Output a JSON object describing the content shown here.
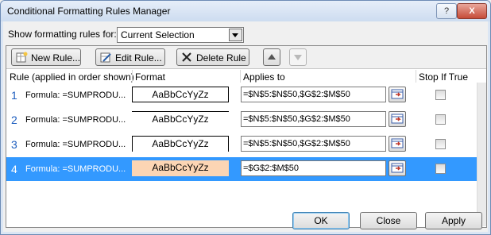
{
  "window": {
    "title": "Conditional Formatting Rules Manager",
    "help": "?",
    "close": "X"
  },
  "show_rules": {
    "label": "Show formatting rules for:",
    "value": "Current Selection"
  },
  "toolbar": {
    "new_rule": "New Rule...",
    "edit_rule": "Edit Rule...",
    "delete_rule": "Delete Rule"
  },
  "columns": {
    "rule": "Rule (applied in order shown)",
    "format": "Format",
    "applies_to": "Applies to",
    "stop_if_true": "Stop If True"
  },
  "rules": [
    {
      "num": "1",
      "text": "Formula: =SUMPRODU...",
      "preview": "AaBbCcYyZz",
      "applies": "=$N$5:$N$50,$G$2:$M$50",
      "stop": false,
      "selected": false
    },
    {
      "num": "2",
      "text": "Formula: =SUMPRODU...",
      "preview": "AaBbCcYyZz",
      "applies": "=$N$5:$N$50,$G$2:$M$50",
      "stop": false,
      "selected": false
    },
    {
      "num": "3",
      "text": "Formula: =SUMPRODU...",
      "preview": "AaBbCcYyZz",
      "applies": "=$N$5:$N$50,$G$2:$M$50",
      "stop": false,
      "selected": false
    },
    {
      "num": "4",
      "text": "Formula: =SUMPRODU...",
      "preview": "AaBbCcYyZz",
      "applies": "=$G$2:$M$50",
      "stop": false,
      "selected": true
    }
  ],
  "footer": {
    "ok": "OK",
    "close": "Close",
    "apply": "Apply"
  },
  "colors": {
    "selection": "#3399ff",
    "rule4_fill": "#fcd5b4"
  }
}
